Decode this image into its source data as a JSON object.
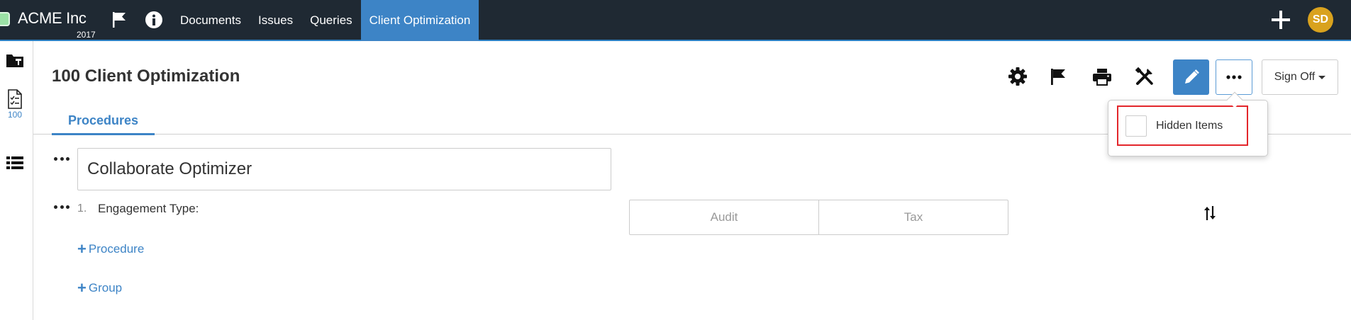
{
  "brand": {
    "name": "ACME Inc",
    "year": "2017"
  },
  "topbar": {
    "flag_icon": "flag-icon",
    "info_icon": "info-icon",
    "nav": [
      "Documents",
      "Issues",
      "Queries",
      "Client Optimization"
    ],
    "active_nav": "Client Optimization",
    "add_icon": "plus-icon",
    "avatar_initials": "SD"
  },
  "rail": {
    "items": [
      {
        "icon": "folder-pin-icon"
      },
      {
        "icon": "checklist-document-icon",
        "label": "100"
      },
      {
        "icon": "list-icon"
      }
    ]
  },
  "page": {
    "title": "100 Client Optimization",
    "toolbar_icons": [
      "gear-icon",
      "flag-icon",
      "print-icon",
      "tools-icon",
      "pencil-icon",
      "more-icon"
    ],
    "sign_off_label": "Sign Off"
  },
  "tabs": [
    {
      "label": "Procedures",
      "active": true
    }
  ],
  "dropdown": {
    "hidden_items_label": "Hidden Items",
    "checked": false
  },
  "content": {
    "group_title": "Collaborate Optimizer",
    "step": {
      "number": "1.",
      "label": "Engagement Type:",
      "options": [
        "Audit",
        "Tax"
      ]
    },
    "add_procedure": "Procedure",
    "add_group": "Group"
  },
  "colors": {
    "topbar_bg": "#1f2933",
    "accent": "#3d84c6",
    "avatar": "#d9a21e",
    "highlight_border": "#e3262b"
  }
}
